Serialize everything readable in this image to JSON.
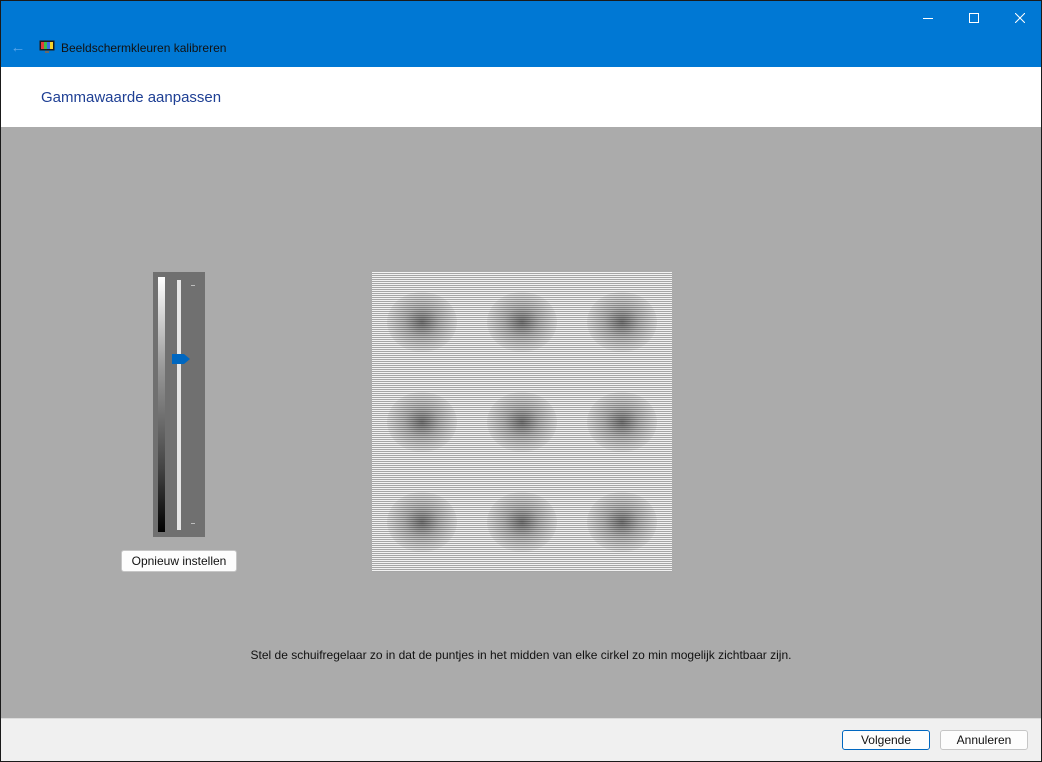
{
  "window": {
    "title": "Beeldschermkleuren kalibreren",
    "accent_color": "#0078d4",
    "icons": [
      "back-arrow-icon",
      "display-color-icon",
      "minimize-icon",
      "maximize-icon",
      "close-icon"
    ]
  },
  "page": {
    "title": "Gammawaarde aanpassen",
    "title_color": "#1e3f94",
    "background_color": "#ababab"
  },
  "slider": {
    "reset_label": "Opnieuw instellen",
    "value_fraction": 0.31
  },
  "instruction": "Stel de schuifregelaar zo in dat de puntjes in het midden van elke cirkel zo min mogelijk zichtbaar zijn.",
  "footer": {
    "next_label": "Volgende",
    "cancel_label": "Annuleren"
  }
}
